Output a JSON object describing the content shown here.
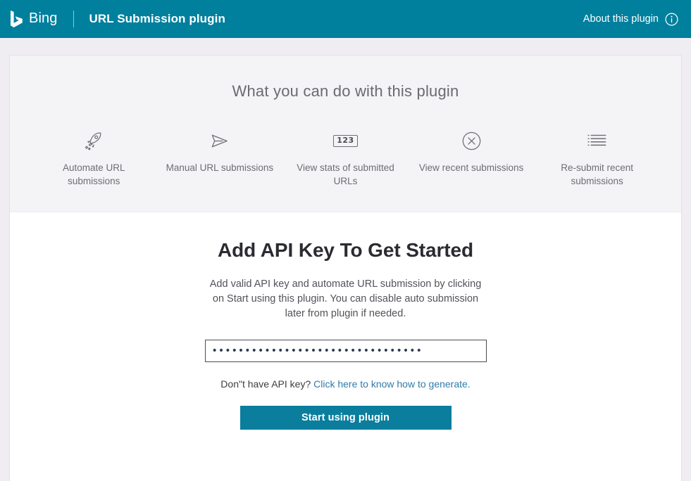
{
  "header": {
    "logo_text": "Bing",
    "logo_icon": "bing-logo-icon",
    "plugin_title": "URL Submission plugin",
    "about_label": "About this plugin",
    "about_icon": "info-circle-icon",
    "background_color": "#00809d"
  },
  "features": {
    "heading": "What you can do with this plugin",
    "items": [
      {
        "icon": "rocket-icon",
        "label": "Automate URL submissions"
      },
      {
        "icon": "paper-plane-icon",
        "label": "Manual URL submissions"
      },
      {
        "icon": "number-box-icon",
        "icon_text": "123",
        "label": "View stats of submitted URLs"
      },
      {
        "icon": "circle-x-icon",
        "label": "View recent submissions"
      },
      {
        "icon": "list-icon",
        "label": "Re-submit recent submissions"
      }
    ]
  },
  "apikey": {
    "heading": "Add API Key To Get Started",
    "description": "Add valid API key and automate URL submission by clicking on Start using this plugin. You can disable auto submission later from plugin if needed.",
    "input_value": "••••••••••••••••••••••••••••••••",
    "input_placeholder": "",
    "helper_text": "Don\"t have API key?",
    "helper_link_text": "Click here to know how to generate.",
    "submit_label": "Start using plugin",
    "accent_color": "#0b7e9e",
    "link_color": "#2e7ca8"
  }
}
